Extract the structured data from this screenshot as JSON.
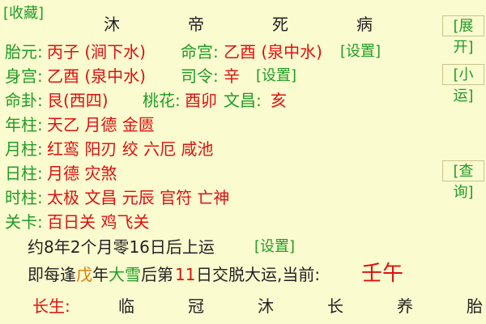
{
  "top": {
    "favorite": "[收藏]",
    "stages": [
      "沐",
      "帝",
      "死",
      "病"
    ],
    "expand": "[展开]"
  },
  "rows": {
    "taiyuan": {
      "label": "胎元:",
      "value1": "丙子 (涧下水)",
      "label2": "命宫:",
      "value2": "乙酉 (泉中水)",
      "action": "[设置]"
    },
    "shengong": {
      "label": "身宫:",
      "value1": "乙酉 (泉中水)",
      "label2": "司令:",
      "value2": "辛",
      "action": "[设置]",
      "side": "[小运]"
    },
    "minggua": {
      "label": "命卦:",
      "value1": "艮(西四)",
      "label2": "桃花:",
      "value2": "酉卯",
      "label3": "文昌:",
      "value3": "亥"
    },
    "nianzhu": {
      "label": "年柱:",
      "value": "天乙 月德 金匮"
    },
    "yuezhu": {
      "label": "月柱:",
      "value": "红鸾 阳刃 绞 六厄 咸池"
    },
    "rizhu": {
      "label": "日柱:",
      "value": "月德 灾煞",
      "side": "[查询]"
    },
    "shizhu": {
      "label": "时柱:",
      "value": "太极 文昌 元辰 官符 亡神"
    },
    "guanka": {
      "label": "关卡:",
      "value": "百日关 鸡飞关"
    }
  },
  "yun": {
    "start_text": "约8年2个月零16日后上运",
    "set": "[设置]",
    "every_prefix": "即每逢",
    "every_gan": "戊",
    "every_mid1": "年",
    "every_term": "大雪",
    "every_mid2": "后第",
    "every_day": "11",
    "every_suffix": "日交脱大运,当前:",
    "current": "壬午"
  },
  "changsheng": {
    "label": "长生:",
    "stages": [
      "临",
      "冠",
      "沐",
      "长",
      "养",
      "胎"
    ]
  },
  "colors": {
    "background": "#fbfbd0",
    "green": "#1e9d25",
    "red": "#e01010",
    "orange": "#e07a00"
  }
}
